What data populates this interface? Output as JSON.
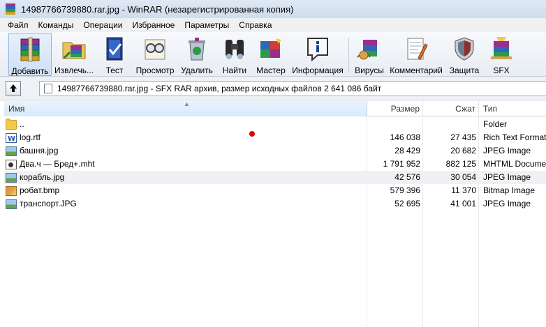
{
  "window": {
    "title": "14987766739880.rar.jpg - WinRAR (незарегистрированная копия)"
  },
  "menu": {
    "items": [
      "Файл",
      "Команды",
      "Операции",
      "Избранное",
      "Параметры",
      "Справка"
    ]
  },
  "toolbar": {
    "buttons": [
      {
        "label": "Добавить",
        "icon": "books-add-icon",
        "active": true
      },
      {
        "label": "Извлечь...",
        "icon": "extract-folder-icon"
      },
      {
        "label": "Тест",
        "icon": "test-check-icon"
      },
      {
        "label": "Просмотр",
        "icon": "view-glasses-icon"
      },
      {
        "label": "Удалить",
        "icon": "delete-recycle-icon"
      },
      {
        "label": "Найти",
        "icon": "find-binoculars-icon"
      },
      {
        "label": "Мастер",
        "icon": "wizard-icon"
      },
      {
        "label": "Информация",
        "icon": "info-icon"
      },
      {
        "label": "Вирусы",
        "icon": "virus-scan-icon"
      },
      {
        "label": "Комментарий",
        "icon": "comment-icon"
      },
      {
        "label": "Защита",
        "icon": "shield-icon"
      },
      {
        "label": "SFX",
        "icon": "sfx-icon"
      }
    ]
  },
  "pathbar": {
    "text": "14987766739880.rar.jpg - SFX RAR архив, размер исходных файлов 2 641 086 байт"
  },
  "columns": {
    "name": "Имя",
    "size": "Размер",
    "packed": "Сжат",
    "type": "Тип"
  },
  "files": [
    {
      "name": "..",
      "size": "",
      "packed": "",
      "type": "Folder",
      "icon": "folder-icon"
    },
    {
      "name": "log.rtf",
      "size": "146 038",
      "packed": "27 435",
      "type": "Rich Text Format",
      "icon": "rtf-file-icon"
    },
    {
      "name": "башня.jpg",
      "size": "28 429",
      "packed": "20 682",
      "type": "JPEG Image",
      "icon": "jpg-file-icon"
    },
    {
      "name": "Два.ч — Бред+.mht",
      "size": "1 791 952",
      "packed": "882 125",
      "type": "MHTML Document",
      "icon": "mht-file-icon"
    },
    {
      "name": "корабль.jpg",
      "size": "42 576",
      "packed": "30 054",
      "type": "JPEG Image",
      "icon": "jpg-file-icon"
    },
    {
      "name": "робат.bmp",
      "size": "579 396",
      "packed": "11 370",
      "type": "Bitmap Image",
      "icon": "bmp-file-icon"
    },
    {
      "name": "транспорт.JPG",
      "size": "52 695",
      "packed": "41 001",
      "type": "JPEG Image",
      "icon": "jpg-file-icon"
    }
  ],
  "colors": {
    "highlight_row": "#eff1f4",
    "header_selected": "#d8eafb",
    "marker": "#e00000"
  }
}
